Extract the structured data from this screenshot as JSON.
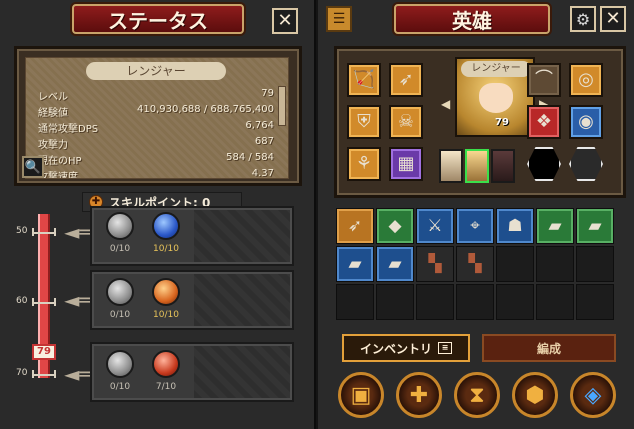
{
  "status_panel": {
    "title": "ステータス",
    "close_icon": "✕",
    "class_name": "レンジャー",
    "stats": [
      {
        "label": "レベル",
        "value": "79"
      },
      {
        "label": "経験値",
        "value": "410,930,688 / 688,765,400"
      },
      {
        "label": "通常攻撃DPS",
        "value": "6,764"
      },
      {
        "label": "攻撃力",
        "value": "687"
      },
      {
        "label": "現在のHP",
        "value": "584 / 584"
      },
      {
        "label": "攻撃速度",
        "value": "4.37"
      }
    ],
    "skill_points_label": "スキルポイント: 0",
    "current_level": "79",
    "levels": [
      "50",
      "60",
      "70"
    ],
    "skill_tiers": [
      {
        "skills": [
          {
            "count": "0/10",
            "style": "gray"
          },
          {
            "count": "10/10",
            "style": "blue"
          }
        ]
      },
      {
        "skills": [
          {
            "count": "0/10",
            "style": "gray"
          },
          {
            "count": "10/10",
            "style": "orange"
          }
        ]
      },
      {
        "skills": [
          {
            "count": "0/10",
            "style": "gray"
          },
          {
            "count": "7/10",
            "style": "red"
          }
        ]
      }
    ]
  },
  "hero_panel": {
    "title": "英雄",
    "hero_name": "レンジャー",
    "hero_level": "79",
    "tabs": {
      "inventory": "インベントリ",
      "formation": "編成"
    }
  },
  "colors": {
    "title_red": "#8e1c1c",
    "gold_border": "#c9a36a",
    "panel_bg": "#2a2a2a",
    "level_bar": "#e04646"
  }
}
